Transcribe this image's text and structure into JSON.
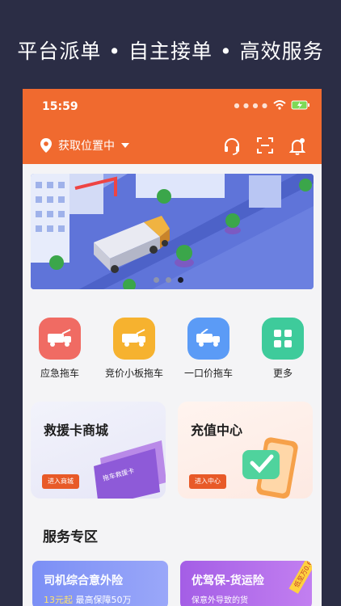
{
  "headline": "平台派单 • 自主接单 • 高效服务",
  "status_bar": {
    "time": "15:59"
  },
  "topbar": {
    "location_label": "获取位置中"
  },
  "quick_actions": [
    {
      "label": "应急拖车",
      "color": "#f06b63"
    },
    {
      "label": "竞价小板拖车",
      "color": "#f6b22f"
    },
    {
      "label": "一口价拖车",
      "color": "#5b9bf6"
    },
    {
      "label": "更多",
      "color": "#3ecb9b"
    }
  ],
  "cards": {
    "rescue": {
      "title": "救援卡商城",
      "button": "进入商城",
      "card_text": "拖车救援卡"
    },
    "recharge": {
      "title": "充值中心",
      "button": "进入中心"
    }
  },
  "section": {
    "title": "服务专区"
  },
  "promos": [
    {
      "title": "司机综合意外险",
      "sub_highlight": "13元起",
      "sub": "最高保障50万"
    },
    {
      "title": "优驾保-货运险",
      "tag": "低至万0.6",
      "sub": "保意外导致的货"
    }
  ],
  "colors": {
    "brand": "#f06a2f",
    "background": "#2b2d45"
  }
}
